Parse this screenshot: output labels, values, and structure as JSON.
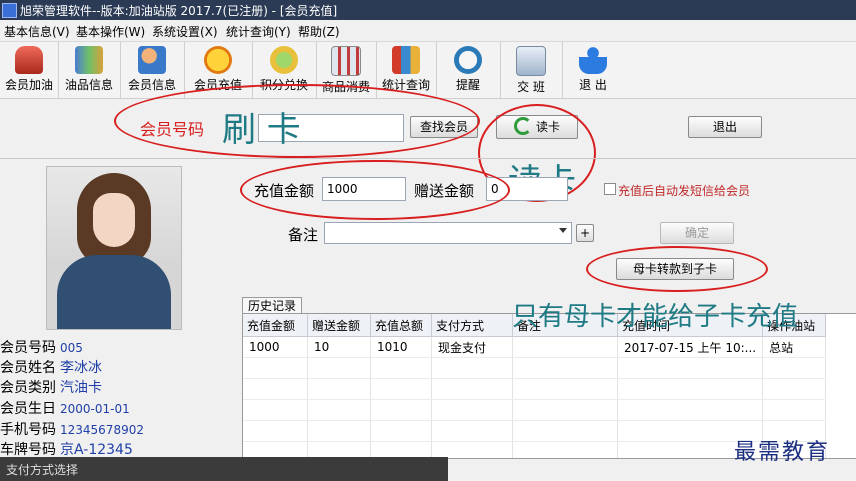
{
  "window": {
    "title": "旭荣管理软件--版本:加油站版 2017.7(已注册) - [会员充值]"
  },
  "menu": [
    "基本信息(V)",
    "基本操作(W)",
    "系统设置(X)",
    "统计查询(Y)",
    "帮助(Z)"
  ],
  "toolbar": [
    {
      "label": "会员加油",
      "icon": "car-icon"
    },
    {
      "label": "油品信息",
      "icon": "oil-drum-icon"
    },
    {
      "label": "会员信息",
      "icon": "users-icon"
    },
    {
      "label": "会员充值",
      "icon": "coin-icon"
    },
    {
      "label": "积分兑换",
      "icon": "points-icon"
    },
    {
      "label": "商品消费",
      "icon": "goods-icon"
    },
    {
      "label": "统计查询",
      "icon": "chart-icon"
    },
    {
      "label": "提醒",
      "icon": "clock-icon"
    },
    {
      "label": "交 班",
      "icon": "handover-icon"
    },
    {
      "label": "退 出",
      "icon": "exit-person-icon"
    }
  ],
  "search": {
    "label": "会员号码",
    "value": "",
    "find_button": "查找会员",
    "read_card_button": "读卡",
    "exit_button": "退出"
  },
  "recharge": {
    "amount_label": "充值金额",
    "amount_value": "1000",
    "bonus_label": "赠送金额",
    "bonus_value": "0",
    "sms_label": "充值后自动发短信给会员",
    "remark_label": "备注",
    "remark_value": "",
    "confirm_button": "确定",
    "transfer_button": "母卡转款到子卡"
  },
  "annotations": {
    "swipe": "刷  卡",
    "read": "读卡",
    "note": "只有母卡才能给子卡充值"
  },
  "member": {
    "rows": [
      {
        "label": "会员号码",
        "value": "005"
      },
      {
        "label": "会员姓名",
        "value": "李冰冰"
      },
      {
        "label": "会员类别",
        "value": "汽油卡"
      },
      {
        "label": "会员生日",
        "value": "2000-01-01"
      },
      {
        "label": "手机号码",
        "value": "12345678902"
      },
      {
        "label": "车牌号码",
        "value": "京A-12345"
      }
    ]
  },
  "history": {
    "tab": "历史记录",
    "columns": [
      "充值金额",
      "赠送金额",
      "充值总额",
      "支付方式",
      "备注",
      "充值时间",
      "操作油站"
    ],
    "rows": [
      [
        "1000",
        "10",
        "1010",
        "现金支付",
        "",
        "2017-07-15 上午 10:...",
        "总站"
      ]
    ]
  },
  "status": {
    "bottom_label": "支付方式选择"
  },
  "watermark": "最需教育",
  "colors": {
    "titlebar": "#2b3a55",
    "annotation_red": "#d81e1e",
    "handwriting_teal": "#1e7a84",
    "value_blue": "#1f3fa8"
  }
}
